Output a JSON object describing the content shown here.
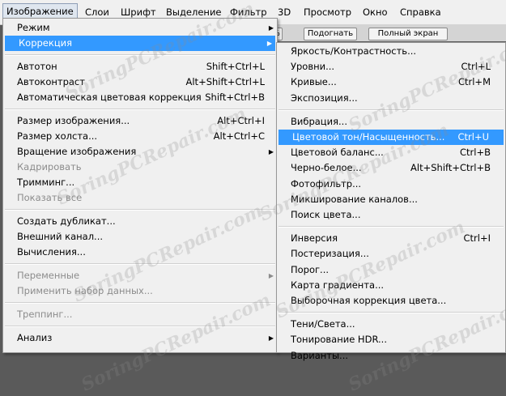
{
  "menubar": [
    "Изображение",
    "Слои",
    "Шрифт",
    "Выделение",
    "Фильтр",
    "3D",
    "Просмотр",
    "Окно",
    "Справка"
  ],
  "options": [
    "%",
    "Подогнать",
    "Полный экран"
  ],
  "main_menu": [
    {
      "label": "Режим",
      "submenu": true
    },
    {
      "label": "Коррекция",
      "submenu": true,
      "highlight": true
    },
    {
      "sep": true
    },
    {
      "label": "Автотон",
      "shortcut": "Shift+Ctrl+L"
    },
    {
      "label": "Автоконтраст",
      "shortcut": "Alt+Shift+Ctrl+L"
    },
    {
      "label": "Автоматическая цветовая коррекция",
      "shortcut": "Shift+Ctrl+B"
    },
    {
      "sep": true
    },
    {
      "label": "Размер изображения...",
      "shortcut": "Alt+Ctrl+I"
    },
    {
      "label": "Размер холста...",
      "shortcut": "Alt+Ctrl+C"
    },
    {
      "label": "Вращение изображения",
      "submenu": true
    },
    {
      "label": "Кадрировать",
      "disabled": true
    },
    {
      "label": "Тримминг..."
    },
    {
      "label": "Показать все",
      "disabled": true
    },
    {
      "sep": true
    },
    {
      "label": "Создать дубликат..."
    },
    {
      "label": "Внешний канал..."
    },
    {
      "label": "Вычисления..."
    },
    {
      "sep": true
    },
    {
      "label": "Переменные",
      "submenu": true,
      "disabled": true
    },
    {
      "label": "Применить набор данных...",
      "disabled": true
    },
    {
      "sep": true
    },
    {
      "label": "Треппинг...",
      "disabled": true
    },
    {
      "sep": true
    },
    {
      "label": "Анализ",
      "submenu": true
    }
  ],
  "sub_menu": [
    {
      "label": "Яркость/Контрастность..."
    },
    {
      "label": "Уровни...",
      "shortcut": "Ctrl+L"
    },
    {
      "label": "Кривые...",
      "shortcut": "Ctrl+M"
    },
    {
      "label": "Экспозиция..."
    },
    {
      "sep": true
    },
    {
      "label": "Вибрация..."
    },
    {
      "label": "Цветовой тон/Насыщенность...",
      "shortcut": "Ctrl+U",
      "highlight": true
    },
    {
      "label": "Цветовой баланс...",
      "shortcut": "Ctrl+B"
    },
    {
      "label": "Черно-белое...",
      "shortcut": "Alt+Shift+Ctrl+B"
    },
    {
      "label": "Фотофильтр..."
    },
    {
      "label": "Микширование каналов..."
    },
    {
      "label": "Поиск цвета..."
    },
    {
      "sep": true
    },
    {
      "label": "Инверсия",
      "shortcut": "Ctrl+I"
    },
    {
      "label": "Постеризация..."
    },
    {
      "label": "Порог..."
    },
    {
      "label": "Карта градиента..."
    },
    {
      "label": "Выборочная коррекция цвета..."
    },
    {
      "sep": true
    },
    {
      "label": "Тени/Света..."
    },
    {
      "label": "Тонирование HDR..."
    },
    {
      "label": "Варианты..."
    }
  ],
  "watermark": "SoringPCRepair.com"
}
